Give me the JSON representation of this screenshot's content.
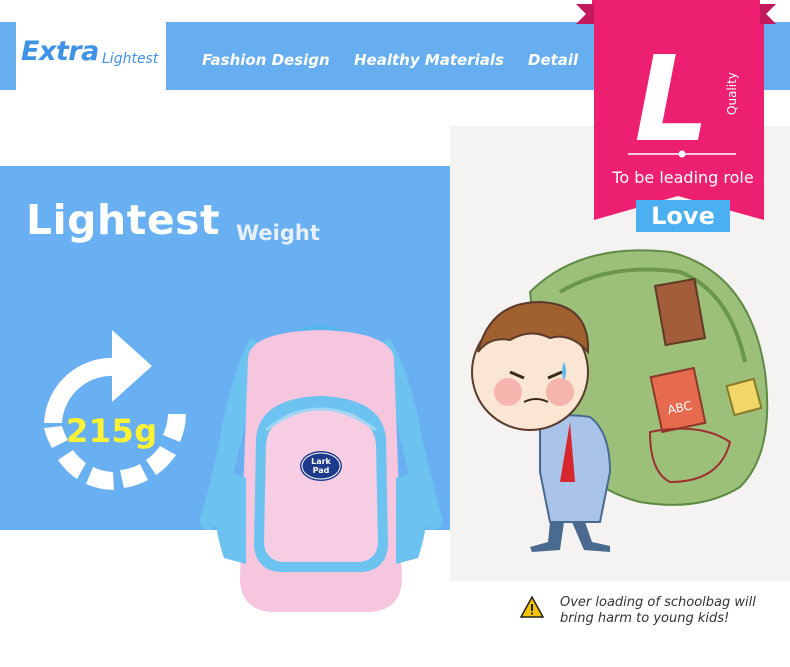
{
  "nav": {
    "brand_main": "Extra",
    "brand_sub": "Lightest",
    "items": [
      "Fashion Design",
      "Healthy Materials",
      "Detail"
    ]
  },
  "feature": {
    "title": "Lightest",
    "subtitle": "Weight",
    "value": "215g"
  },
  "backpack": {
    "logo_line1": "Lark",
    "logo_line2": "Pad"
  },
  "ribbon": {
    "letter": "L",
    "quality": "Quality",
    "tagline": "To be leading role",
    "badge": "Love"
  },
  "warning": {
    "text": "Over loading of schoolbag will bring harm to young kids!"
  },
  "colors": {
    "brand_blue": "#67aef0",
    "ribbon_pink": "#ec1f70",
    "backpack_pink": "#f5c6de",
    "backpack_blue": "#6cc3f0",
    "value_yellow": "#fff232"
  }
}
